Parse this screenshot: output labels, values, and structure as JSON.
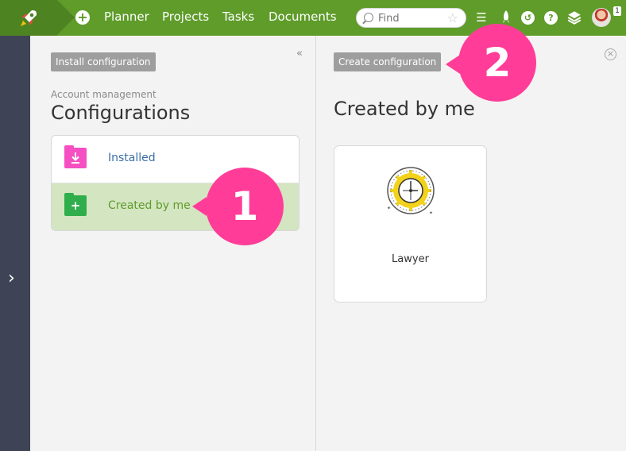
{
  "topbar": {
    "nav": [
      "Planner",
      "Projects",
      "Tasks",
      "Documents"
    ],
    "search_placeholder": "Find",
    "notification_count": "1",
    "icons": [
      "rocket-icon",
      "plus-icon",
      "search-icon",
      "star-icon",
      "menu-icon",
      "rocket-small-icon",
      "help-circle-icon",
      "question-icon",
      "layers-icon"
    ]
  },
  "left_panel": {
    "install_button": "Install configuration",
    "breadcrumb": "Account management",
    "title": "Configurations",
    "items": [
      {
        "label": "Installed",
        "icon": "download-folder-icon",
        "color": "#f54fc2"
      },
      {
        "label": "Created by me",
        "icon": "add-folder-icon",
        "color": "#2fae4b"
      }
    ]
  },
  "right_panel": {
    "create_button": "Create configuration",
    "title": "Created by me",
    "cards": [
      {
        "label": "Lawyer",
        "icon": "gear-clock-icon"
      }
    ]
  },
  "callouts": [
    "1",
    "2"
  ],
  "colors": {
    "topbar": "#5f9c2a",
    "rail": "#3e4455",
    "callout": "#ff3d98",
    "selected_row": "#d4e5c1",
    "selected_text": "#5f9c2a",
    "link_text": "#3a6ea5"
  }
}
